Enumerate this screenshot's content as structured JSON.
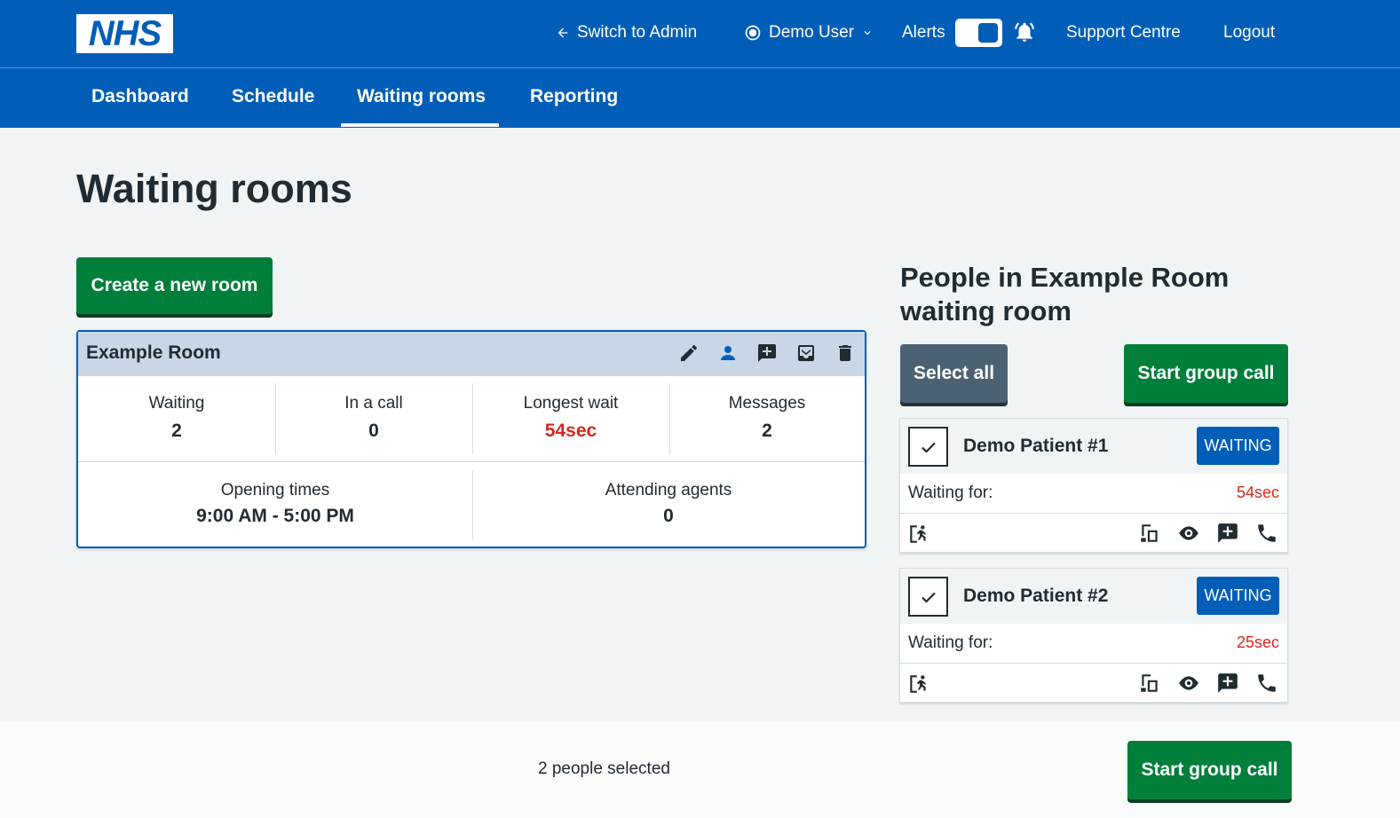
{
  "header": {
    "logo_text": "NHS",
    "switch_admin": "Switch to Admin",
    "user": "Demo User",
    "alerts": "Alerts",
    "support": "Support Centre",
    "logout": "Logout"
  },
  "nav": {
    "items": [
      "Dashboard",
      "Schedule",
      "Waiting rooms",
      "Reporting"
    ],
    "active": "Waiting rooms"
  },
  "page": {
    "title": "Waiting rooms",
    "create_button": "Create a new room"
  },
  "room": {
    "name": "Example Room",
    "stats": [
      {
        "label": "Waiting",
        "value": "2"
      },
      {
        "label": "In a call",
        "value": "0"
      },
      {
        "label": "Longest wait",
        "value": "54sec"
      },
      {
        "label": "Messages",
        "value": "2"
      }
    ],
    "opening_label": "Opening times",
    "opening_value": "9:00 AM - 5:00 PM",
    "agents_label": "Attending agents",
    "agents_value": "0"
  },
  "side": {
    "title": "People in Example Room waiting room",
    "select_all": "Select all",
    "start_group_call": "Start group call",
    "patients": [
      {
        "name": "Demo Patient #1",
        "status": "WAITING",
        "wait_label": "Waiting for:",
        "wait": "54sec"
      },
      {
        "name": "Demo Patient #2",
        "status": "WAITING",
        "wait_label": "Waiting for:",
        "wait": "25sec"
      }
    ]
  },
  "footer": {
    "selected": "2 people selected",
    "start_group_call": "Start group call"
  },
  "colors": {
    "brand_blue": "#005eb8",
    "green": "#007f3b",
    "red": "#d5281b",
    "grey": "#4c6272"
  }
}
